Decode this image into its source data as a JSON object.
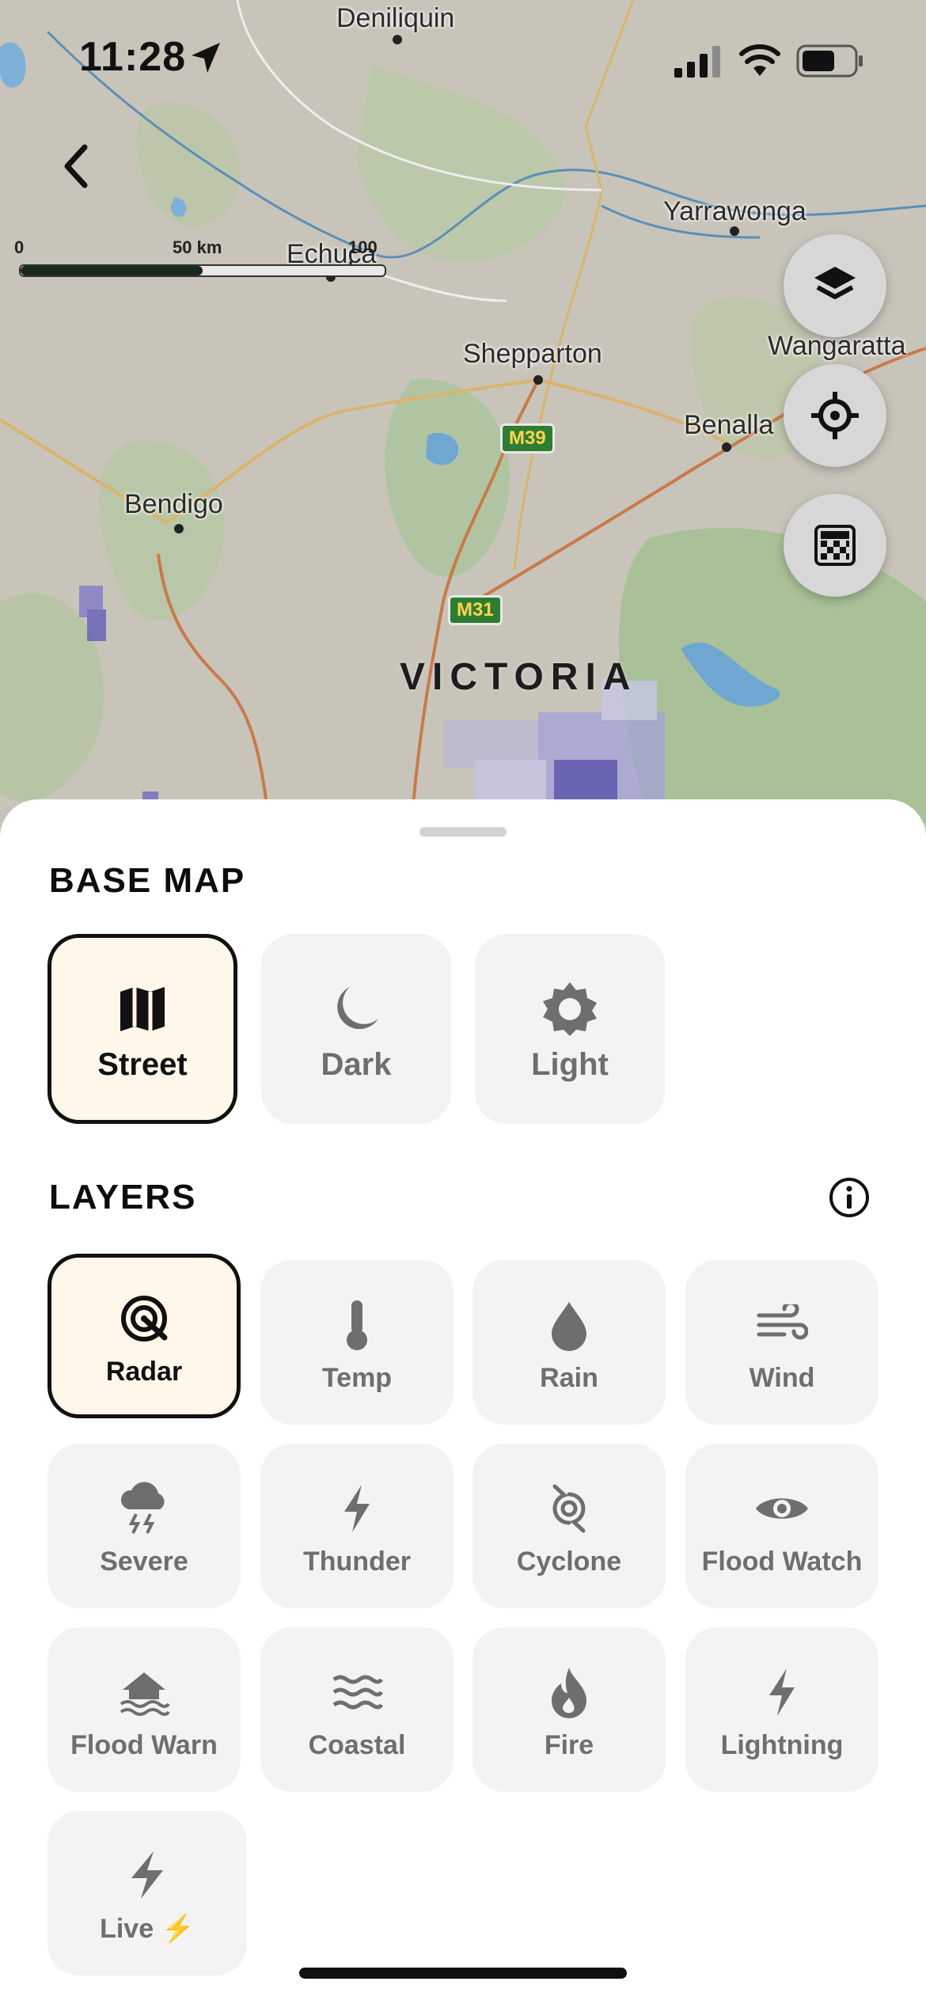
{
  "status_bar": {
    "time": "11:28"
  },
  "map": {
    "scale": {
      "zero": "0",
      "mid": "50 km",
      "end": "100 km",
      "fill_fraction": 0.5
    },
    "places": [
      "Deniliquin",
      "Yarrawonga",
      "Echuca",
      "Shepparton",
      "Wangaratta",
      "Benalla",
      "Bendigo"
    ],
    "region": "VICTORIA",
    "road_shields": [
      "M39",
      "M31"
    ],
    "controls": [
      "layers-icon",
      "locate-icon",
      "legend-icon"
    ]
  },
  "sheet": {
    "base_map_title": "BASE MAP",
    "base_map": [
      {
        "label": "Street",
        "icon": "map-icon",
        "selected": true
      },
      {
        "label": "Dark",
        "icon": "moon-icon",
        "selected": false
      },
      {
        "label": "Light",
        "icon": "sun-icon",
        "selected": false
      }
    ],
    "layers_title": "LAYERS",
    "layers": [
      {
        "label": "Radar",
        "icon": "radar-icon",
        "selected": true
      },
      {
        "label": "Temp",
        "icon": "thermometer-icon"
      },
      {
        "label": "Rain",
        "icon": "raindrop-icon"
      },
      {
        "label": "Wind",
        "icon": "wind-icon"
      },
      {
        "label": "Severe",
        "icon": "storm-cloud-icon"
      },
      {
        "label": "Thunder",
        "icon": "bolt-icon"
      },
      {
        "label": "Cyclone",
        "icon": "cyclone-icon"
      },
      {
        "label": "Flood Watch",
        "icon": "eye-icon"
      },
      {
        "label": "Flood Warn",
        "icon": "flood-house-icon"
      },
      {
        "label": "Coastal",
        "icon": "waves-icon"
      },
      {
        "label": "Fire",
        "icon": "flame-icon"
      },
      {
        "label": "Lightning",
        "icon": "bolt-icon"
      },
      {
        "label": "Live",
        "icon": "bolt-icon",
        "badge": "⚡"
      }
    ],
    "accent_colors": {
      "selected_bg": "#fff8ea",
      "selected_border": "#111111",
      "card_bg": "#f3f3f3",
      "card_text": "#6e6e6e"
    }
  }
}
